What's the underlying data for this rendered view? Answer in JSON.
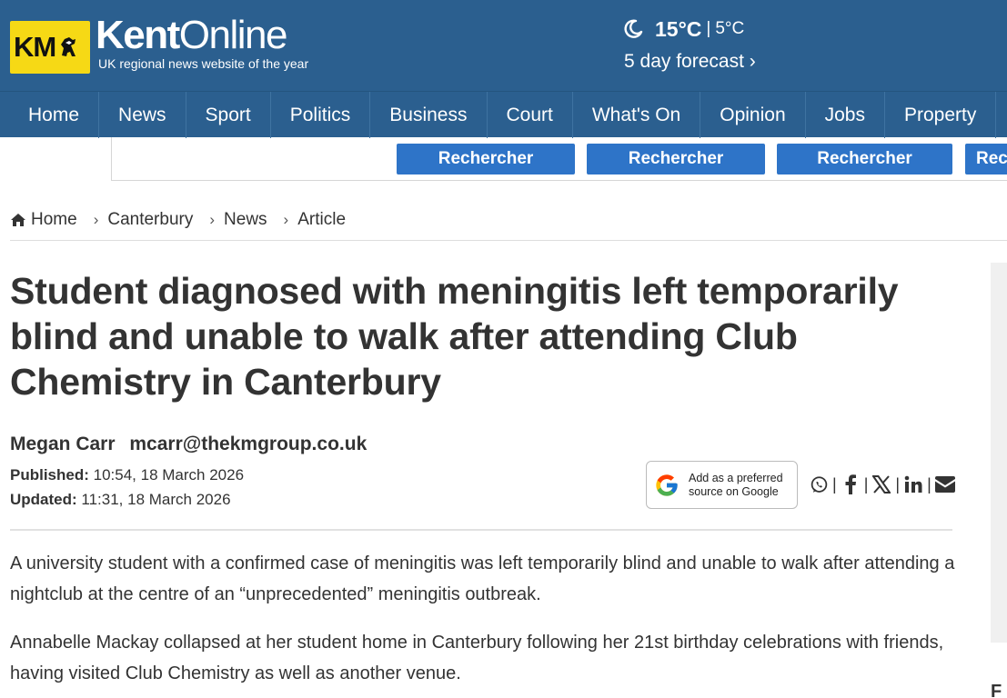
{
  "header": {
    "logo_text": "KM",
    "brand_bold": "Kent",
    "brand_light": "Online",
    "tagline": "UK regional news website of the year",
    "weather": {
      "icon": "moon-icon",
      "high": "15°C",
      "separator": "|",
      "low": "5°C",
      "forecast_link": "5 day forecast ›"
    }
  },
  "nav": {
    "items": [
      "Home",
      "News",
      "Sport",
      "Politics",
      "Business",
      "Court",
      "What's On",
      "Opinion",
      "Jobs",
      "Property"
    ]
  },
  "search": {
    "buttons": [
      "Rechercher",
      "Rechercher",
      "Rechercher",
      "Rechercher"
    ]
  },
  "breadcrumb": {
    "items": [
      "Home",
      "Canterbury",
      "News",
      "Article"
    ],
    "separator": "›"
  },
  "article": {
    "headline": "Student diagnosed with meningitis left temporarily blind and unable to walk after attending Club Chemistry in Canterbury",
    "author": "Megan Carr",
    "email": "mcarr@thekmgroup.co.uk",
    "published_label": "Published:",
    "published_value": "10:54, 18 March 2026",
    "updated_label": "Updated:",
    "updated_value": "11:31, 18 March 2026",
    "google_button_line1": "Add as a preferred",
    "google_button_line2": "source on Google",
    "share_icons": [
      "whatsapp-icon",
      "facebook-icon",
      "x-icon",
      "linkedin-icon",
      "email-icon"
    ],
    "share_separator": "|",
    "paragraphs": [
      "A university student with a confirmed case of meningitis was left temporarily blind and unable to walk after attending a nightclub at the centre of an “unprecedented” meningitis outbreak.",
      "Annabelle Mackay collapsed at her student home in Canterbury following her 21st birthday celebrations with friends, having visited Club Chemistry as well as another venue."
    ]
  },
  "sidebar": {
    "partial_letter": "F"
  },
  "colors": {
    "header_blue": "#2b5f8f",
    "logo_yellow": "#f6d915",
    "button_blue": "#2e74c8",
    "text": "#333333"
  }
}
